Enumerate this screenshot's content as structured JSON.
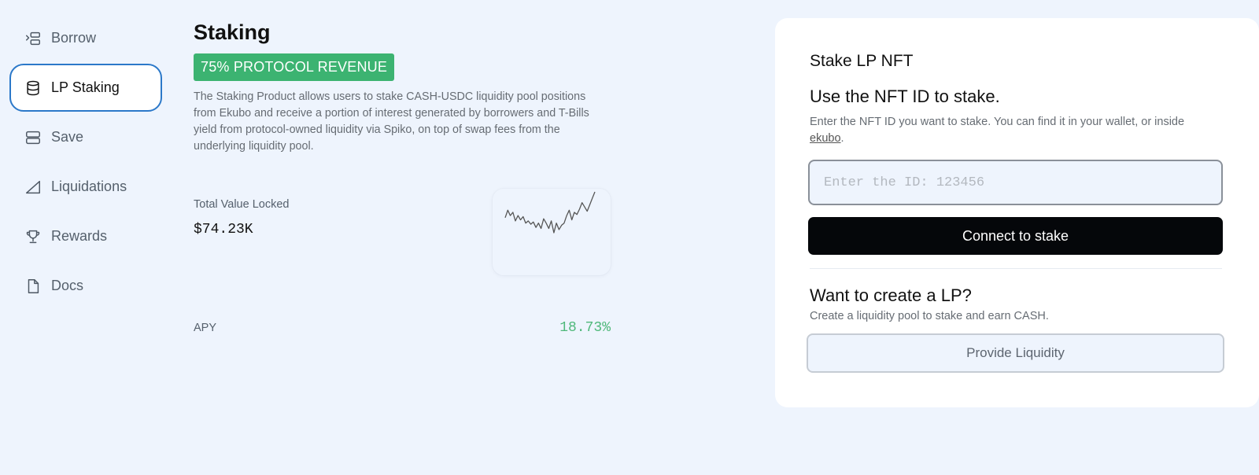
{
  "sidebar": {
    "items": [
      {
        "label": "Borrow",
        "icon": "borrow-icon",
        "active": false
      },
      {
        "label": "LP Staking",
        "icon": "database-icon",
        "active": true
      },
      {
        "label": "Save",
        "icon": "stack-icon",
        "active": false
      },
      {
        "label": "Liquidations",
        "icon": "triangle-icon",
        "active": false
      },
      {
        "label": "Rewards",
        "icon": "trophy-icon",
        "active": false
      },
      {
        "label": "Docs",
        "icon": "document-icon",
        "active": false
      }
    ]
  },
  "main": {
    "title": "Staking",
    "badge": "75% PROTOCOL REVENUE",
    "badge_color": "#3cb371",
    "description": "The Staking Product allows users to stake CASH-USDC liquidity pool positions from Ekubo and receive a portion of interest generated by borrowers and T-Bills yield from protocol-owned liquidity via Spiko, on top of swap fees from the underlying liquidity pool.",
    "tvl_label": "Total Value Locked",
    "tvl_value": "$74.23K",
    "tvl_trend": [
      24,
      31,
      26,
      29,
      21,
      26,
      22,
      25,
      19,
      21,
      18,
      20,
      15,
      19,
      14,
      23,
      19,
      14,
      21,
      10,
      19,
      13,
      17,
      19,
      26,
      31,
      22,
      29,
      27,
      32,
      38,
      34,
      30,
      36,
      42,
      48
    ],
    "apy_label": "APY",
    "apy_value": "18.73%",
    "apy_color": "#4fb87a"
  },
  "stake_card": {
    "title": "Stake LP NFT",
    "subtitle": "Use the NFT ID to stake.",
    "text_before_link": "Enter the NFT ID you want to stake. You can find it in your wallet, or inside ",
    "link_text": "ekubo",
    "text_after_link": ".",
    "input_placeholder": "Enter the ID: 123456",
    "input_value": "",
    "connect_label": "Connect to stake",
    "lp_title": "Want to create a LP?",
    "lp_text": "Create a liquidity pool to stake and earn CASH.",
    "provide_label": "Provide Liquidity"
  }
}
